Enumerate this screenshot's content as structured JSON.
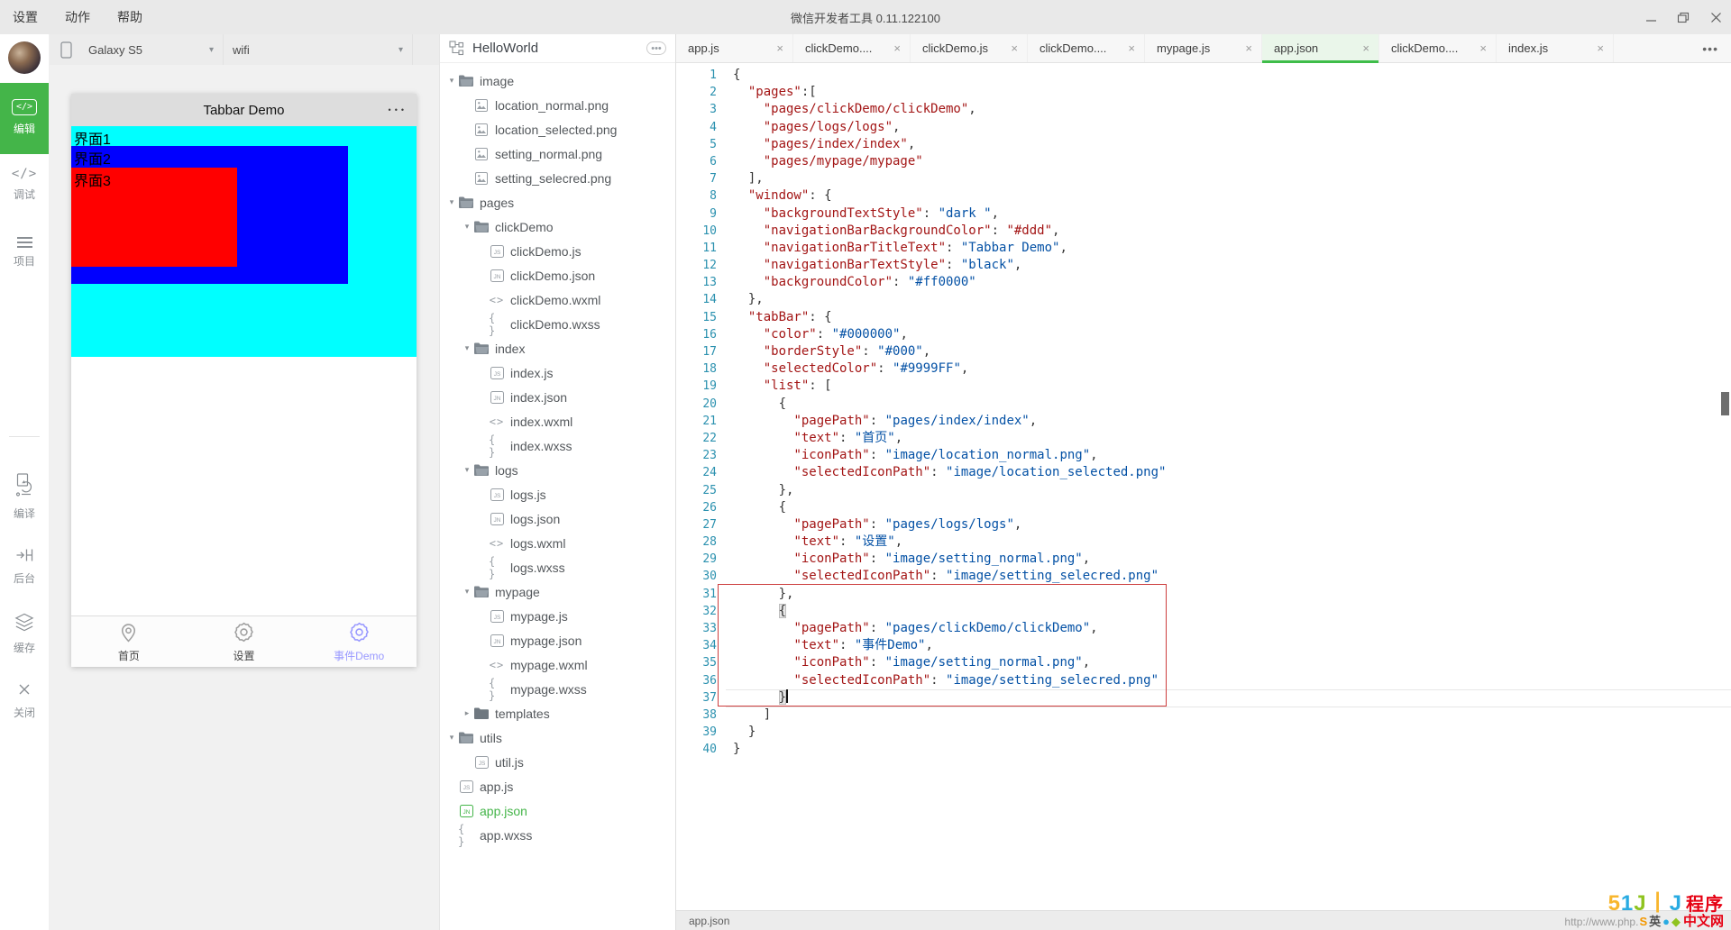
{
  "titlebar": {
    "menus": [
      "设置",
      "动作",
      "帮助"
    ],
    "title": "微信开发者工具 0.11.122100"
  },
  "toolbar": {
    "device": "Galaxy S5",
    "network": "wifi"
  },
  "sidebar": {
    "top": [
      {
        "icon": "code-box",
        "label": "编辑",
        "active": true
      },
      {
        "icon": "code",
        "label": "调试",
        "active": false
      },
      {
        "icon": "menu",
        "label": "项目",
        "active": false
      }
    ],
    "bottom": [
      {
        "icon": "compile",
        "label": "编译"
      },
      {
        "icon": "background",
        "label": "后台"
      },
      {
        "icon": "cache",
        "label": "缓存"
      },
      {
        "icon": "close",
        "label": "关闭"
      }
    ]
  },
  "phone": {
    "title": "Tabbar Demo",
    "dots": "•••",
    "screens": [
      "界面1",
      "界面2",
      "界面3"
    ],
    "tabbar": [
      {
        "icon": "pin",
        "label": "首页",
        "selected": false
      },
      {
        "icon": "gear",
        "label": "设置",
        "selected": false
      },
      {
        "icon": "gear",
        "label": "事件Demo",
        "selected": true
      }
    ],
    "selected_color": "#9999FF",
    "nav_bg": "#dddddd",
    "view_colors": [
      "#00ffff",
      "#0000ff",
      "#ff0000"
    ]
  },
  "filetree": {
    "project": "HelloWorld",
    "nodes": [
      {
        "caret": "open",
        "icon": "folder-open",
        "label": "image",
        "depth": 0
      },
      {
        "icon": "image-file",
        "label": "location_normal.png",
        "depth": 1
      },
      {
        "icon": "image-file",
        "label": "location_selected.png",
        "depth": 1
      },
      {
        "icon": "image-file",
        "label": "setting_normal.png",
        "depth": 1
      },
      {
        "icon": "image-file",
        "label": "setting_selecred.png",
        "depth": 1
      },
      {
        "caret": "open",
        "icon": "folder-open",
        "label": "pages",
        "depth": 0
      },
      {
        "caret": "open",
        "icon": "folder-open",
        "label": "clickDemo",
        "depth": 1
      },
      {
        "icon": "js-badge",
        "label": "clickDemo.js",
        "depth": 2
      },
      {
        "icon": "jn-badge",
        "label": "clickDemo.json",
        "depth": 2
      },
      {
        "icon": "wxml",
        "label": "clickDemo.wxml",
        "depth": 2
      },
      {
        "icon": "wxss",
        "label": "clickDemo.wxss",
        "depth": 2
      },
      {
        "caret": "open",
        "icon": "folder-open",
        "label": "index",
        "depth": 1
      },
      {
        "icon": "js-badge",
        "label": "index.js",
        "depth": 2
      },
      {
        "icon": "jn-badge",
        "label": "index.json",
        "depth": 2
      },
      {
        "icon": "wxml",
        "label": "index.wxml",
        "depth": 2
      },
      {
        "icon": "wxss",
        "label": "index.wxss",
        "depth": 2
      },
      {
        "caret": "open",
        "icon": "folder-open",
        "label": "logs",
        "depth": 1
      },
      {
        "icon": "js-badge",
        "label": "logs.js",
        "depth": 2
      },
      {
        "icon": "jn-badge",
        "label": "logs.json",
        "depth": 2
      },
      {
        "icon": "wxml",
        "label": "logs.wxml",
        "depth": 2
      },
      {
        "icon": "wxss",
        "label": "logs.wxss",
        "depth": 2
      },
      {
        "caret": "open",
        "icon": "folder-open",
        "label": "mypage",
        "depth": 1
      },
      {
        "icon": "js-badge",
        "label": "mypage.js",
        "depth": 2
      },
      {
        "icon": "jn-badge",
        "label": "mypage.json",
        "depth": 2
      },
      {
        "icon": "wxml",
        "label": "mypage.wxml",
        "depth": 2
      },
      {
        "icon": "wxss",
        "label": "mypage.wxss",
        "depth": 2
      },
      {
        "caret": "closed",
        "icon": "folder-closed",
        "label": "templates",
        "depth": 1
      },
      {
        "caret": "open",
        "icon": "folder-open",
        "label": "utils",
        "depth": 0
      },
      {
        "icon": "js-badge",
        "label": "util.js",
        "depth": 1
      },
      {
        "icon": "js-badge",
        "label": "app.js",
        "depth": 0
      },
      {
        "icon": "jn-badge",
        "label": "app.json",
        "depth": 0,
        "selected": true
      },
      {
        "icon": "wxss",
        "label": "app.wxss",
        "depth": 0
      }
    ]
  },
  "editor": {
    "tabs": [
      {
        "label": "app.js",
        "active": false
      },
      {
        "label": "clickDemo....",
        "active": false
      },
      {
        "label": "clickDemo.js",
        "active": false
      },
      {
        "label": "clickDemo....",
        "active": false
      },
      {
        "label": "mypage.js",
        "active": false
      },
      {
        "label": "app.json",
        "active": true
      },
      {
        "label": "clickDemo....",
        "active": false
      },
      {
        "label": "index.js",
        "active": false
      }
    ],
    "status": "app.json",
    "lines": [
      [
        [
          "p",
          "{"
        ]
      ],
      [
        [
          "w",
          "  "
        ],
        [
          "k",
          "\"pages\""
        ],
        [
          "p",
          ":["
        ]
      ],
      [
        [
          "w",
          "    "
        ],
        [
          "k",
          "\"pages/clickDemo/clickDemo\""
        ],
        [
          "p",
          ","
        ]
      ],
      [
        [
          "w",
          "    "
        ],
        [
          "k",
          "\"pages/logs/logs\""
        ],
        [
          "p",
          ","
        ]
      ],
      [
        [
          "w",
          "    "
        ],
        [
          "k",
          "\"pages/index/index\""
        ],
        [
          "p",
          ","
        ]
      ],
      [
        [
          "w",
          "    "
        ],
        [
          "k",
          "\"pages/mypage/mypage\""
        ]
      ],
      [
        [
          "w",
          "  "
        ],
        [
          "p",
          "],"
        ]
      ],
      [
        [
          "w",
          "  "
        ],
        [
          "k",
          "\"window\""
        ],
        [
          "p",
          ": {"
        ]
      ],
      [
        [
          "w",
          "    "
        ],
        [
          "k",
          "\"backgroundTextStyle\""
        ],
        [
          "p",
          ": "
        ],
        [
          "v",
          "\"dark \""
        ],
        [
          "p",
          ","
        ]
      ],
      [
        [
          "w",
          "    "
        ],
        [
          "k",
          "\"navigationBarBackgroundColor\""
        ],
        [
          "p",
          ": "
        ],
        [
          "k",
          "\"#ddd\""
        ],
        [
          "p",
          ","
        ]
      ],
      [
        [
          "w",
          "    "
        ],
        [
          "k",
          "\"navigationBarTitleText\""
        ],
        [
          "p",
          ": "
        ],
        [
          "v",
          "\"Tabbar Demo\""
        ],
        [
          "p",
          ","
        ]
      ],
      [
        [
          "w",
          "    "
        ],
        [
          "k",
          "\"navigationBarTextStyle\""
        ],
        [
          "p",
          ": "
        ],
        [
          "v",
          "\"black\""
        ],
        [
          "p",
          ","
        ]
      ],
      [
        [
          "w",
          "    "
        ],
        [
          "k",
          "\"backgroundColor\""
        ],
        [
          "p",
          ": "
        ],
        [
          "v",
          "\"#ff0000\""
        ]
      ],
      [
        [
          "w",
          "  "
        ],
        [
          "p",
          "},"
        ]
      ],
      [
        [
          "w",
          "  "
        ],
        [
          "k",
          "\"tabBar\""
        ],
        [
          "p",
          ": {"
        ]
      ],
      [
        [
          "w",
          "    "
        ],
        [
          "k",
          "\"color\""
        ],
        [
          "p",
          ": "
        ],
        [
          "v",
          "\"#000000\""
        ],
        [
          "p",
          ","
        ]
      ],
      [
        [
          "w",
          "    "
        ],
        [
          "k",
          "\"borderStyle\""
        ],
        [
          "p",
          ": "
        ],
        [
          "v",
          "\"#000\""
        ],
        [
          "p",
          ","
        ]
      ],
      [
        [
          "w",
          "    "
        ],
        [
          "k",
          "\"selectedColor\""
        ],
        [
          "p",
          ": "
        ],
        [
          "v",
          "\"#9999FF\""
        ],
        [
          "p",
          ","
        ]
      ],
      [
        [
          "w",
          "    "
        ],
        [
          "k",
          "\"list\""
        ],
        [
          "p",
          ": ["
        ]
      ],
      [
        [
          "w",
          "      "
        ],
        [
          "p",
          "{"
        ]
      ],
      [
        [
          "w",
          "        "
        ],
        [
          "k",
          "\"pagePath\""
        ],
        [
          "p",
          ": "
        ],
        [
          "v",
          "\"pages/index/index\""
        ],
        [
          "p",
          ","
        ]
      ],
      [
        [
          "w",
          "        "
        ],
        [
          "k",
          "\"text\""
        ],
        [
          "p",
          ": "
        ],
        [
          "v",
          "\"首页\""
        ],
        [
          "p",
          ","
        ]
      ],
      [
        [
          "w",
          "        "
        ],
        [
          "k",
          "\"iconPath\""
        ],
        [
          "p",
          ": "
        ],
        [
          "v",
          "\"image/location_normal.png\""
        ],
        [
          "p",
          ","
        ]
      ],
      [
        [
          "w",
          "        "
        ],
        [
          "k",
          "\"selectedIconPath\""
        ],
        [
          "p",
          ": "
        ],
        [
          "v",
          "\"image/location_selected.png\""
        ]
      ],
      [
        [
          "w",
          "      "
        ],
        [
          "p",
          "},"
        ]
      ],
      [
        [
          "w",
          "      "
        ],
        [
          "p",
          "{"
        ]
      ],
      [
        [
          "w",
          "        "
        ],
        [
          "k",
          "\"pagePath\""
        ],
        [
          "p",
          ": "
        ],
        [
          "v",
          "\"pages/logs/logs\""
        ],
        [
          "p",
          ","
        ]
      ],
      [
        [
          "w",
          "        "
        ],
        [
          "k",
          "\"text\""
        ],
        [
          "p",
          ": "
        ],
        [
          "v",
          "\"设置\""
        ],
        [
          "p",
          ","
        ]
      ],
      [
        [
          "w",
          "        "
        ],
        [
          "k",
          "\"iconPath\""
        ],
        [
          "p",
          ": "
        ],
        [
          "v",
          "\"image/setting_normal.png\""
        ],
        [
          "p",
          ","
        ]
      ],
      [
        [
          "w",
          "        "
        ],
        [
          "k",
          "\"selectedIconPath\""
        ],
        [
          "p",
          ": "
        ],
        [
          "v",
          "\"image/setting_selecred.png\""
        ]
      ],
      [
        [
          "w",
          "      "
        ],
        [
          "p",
          "},"
        ]
      ],
      [
        [
          "w",
          "      "
        ],
        [
          "hb",
          "{"
        ]
      ],
      [
        [
          "w",
          "        "
        ],
        [
          "k",
          "\"pagePath\""
        ],
        [
          "p",
          ": "
        ],
        [
          "v",
          "\"pages/clickDemo/clickDemo\""
        ],
        [
          "p",
          ","
        ]
      ],
      [
        [
          "w",
          "        "
        ],
        [
          "k",
          "\"text\""
        ],
        [
          "p",
          ": "
        ],
        [
          "v",
          "\"事件Demo\""
        ],
        [
          "p",
          ","
        ]
      ],
      [
        [
          "w",
          "        "
        ],
        [
          "k",
          "\"iconPath\""
        ],
        [
          "p",
          ": "
        ],
        [
          "v",
          "\"image/setting_normal.png\""
        ],
        [
          "p",
          ","
        ]
      ],
      [
        [
          "w",
          "        "
        ],
        [
          "k",
          "\"selectedIconPath\""
        ],
        [
          "p",
          ": "
        ],
        [
          "v",
          "\"image/setting_selecred.png\""
        ]
      ],
      [
        [
          "w",
          "      "
        ],
        [
          "hb",
          "}"
        ],
        [
          "cur",
          ""
        ]
      ],
      [
        [
          "w",
          "    "
        ],
        [
          "p",
          "]"
        ]
      ],
      [
        [
          "w",
          "  "
        ],
        [
          "p",
          "}"
        ]
      ],
      [
        [
          "p",
          "}"
        ]
      ]
    ],
    "colors": {
      "key": "#A31515",
      "value": "#0451A5",
      "accent": "#44b549",
      "error_box": "#cd3d3d"
    }
  },
  "watermark": {
    "glyphs": [
      [
        "5",
        "#f8b62d"
      ],
      [
        "1",
        "#29abe2"
      ],
      [
        "J",
        "#8fc31f"
      ],
      [
        "丨",
        "#f8b62d"
      ],
      [
        "J",
        "#29abe2"
      ]
    ],
    "title": "程序",
    "url": "http://www.php.",
    "badges": [
      [
        "S",
        "#f39800"
      ],
      [
        "英",
        "#4d4d4d"
      ],
      [
        "●",
        "#29abe2"
      ],
      [
        "◆",
        "#8fc31f"
      ]
    ],
    "site": "中文网"
  }
}
